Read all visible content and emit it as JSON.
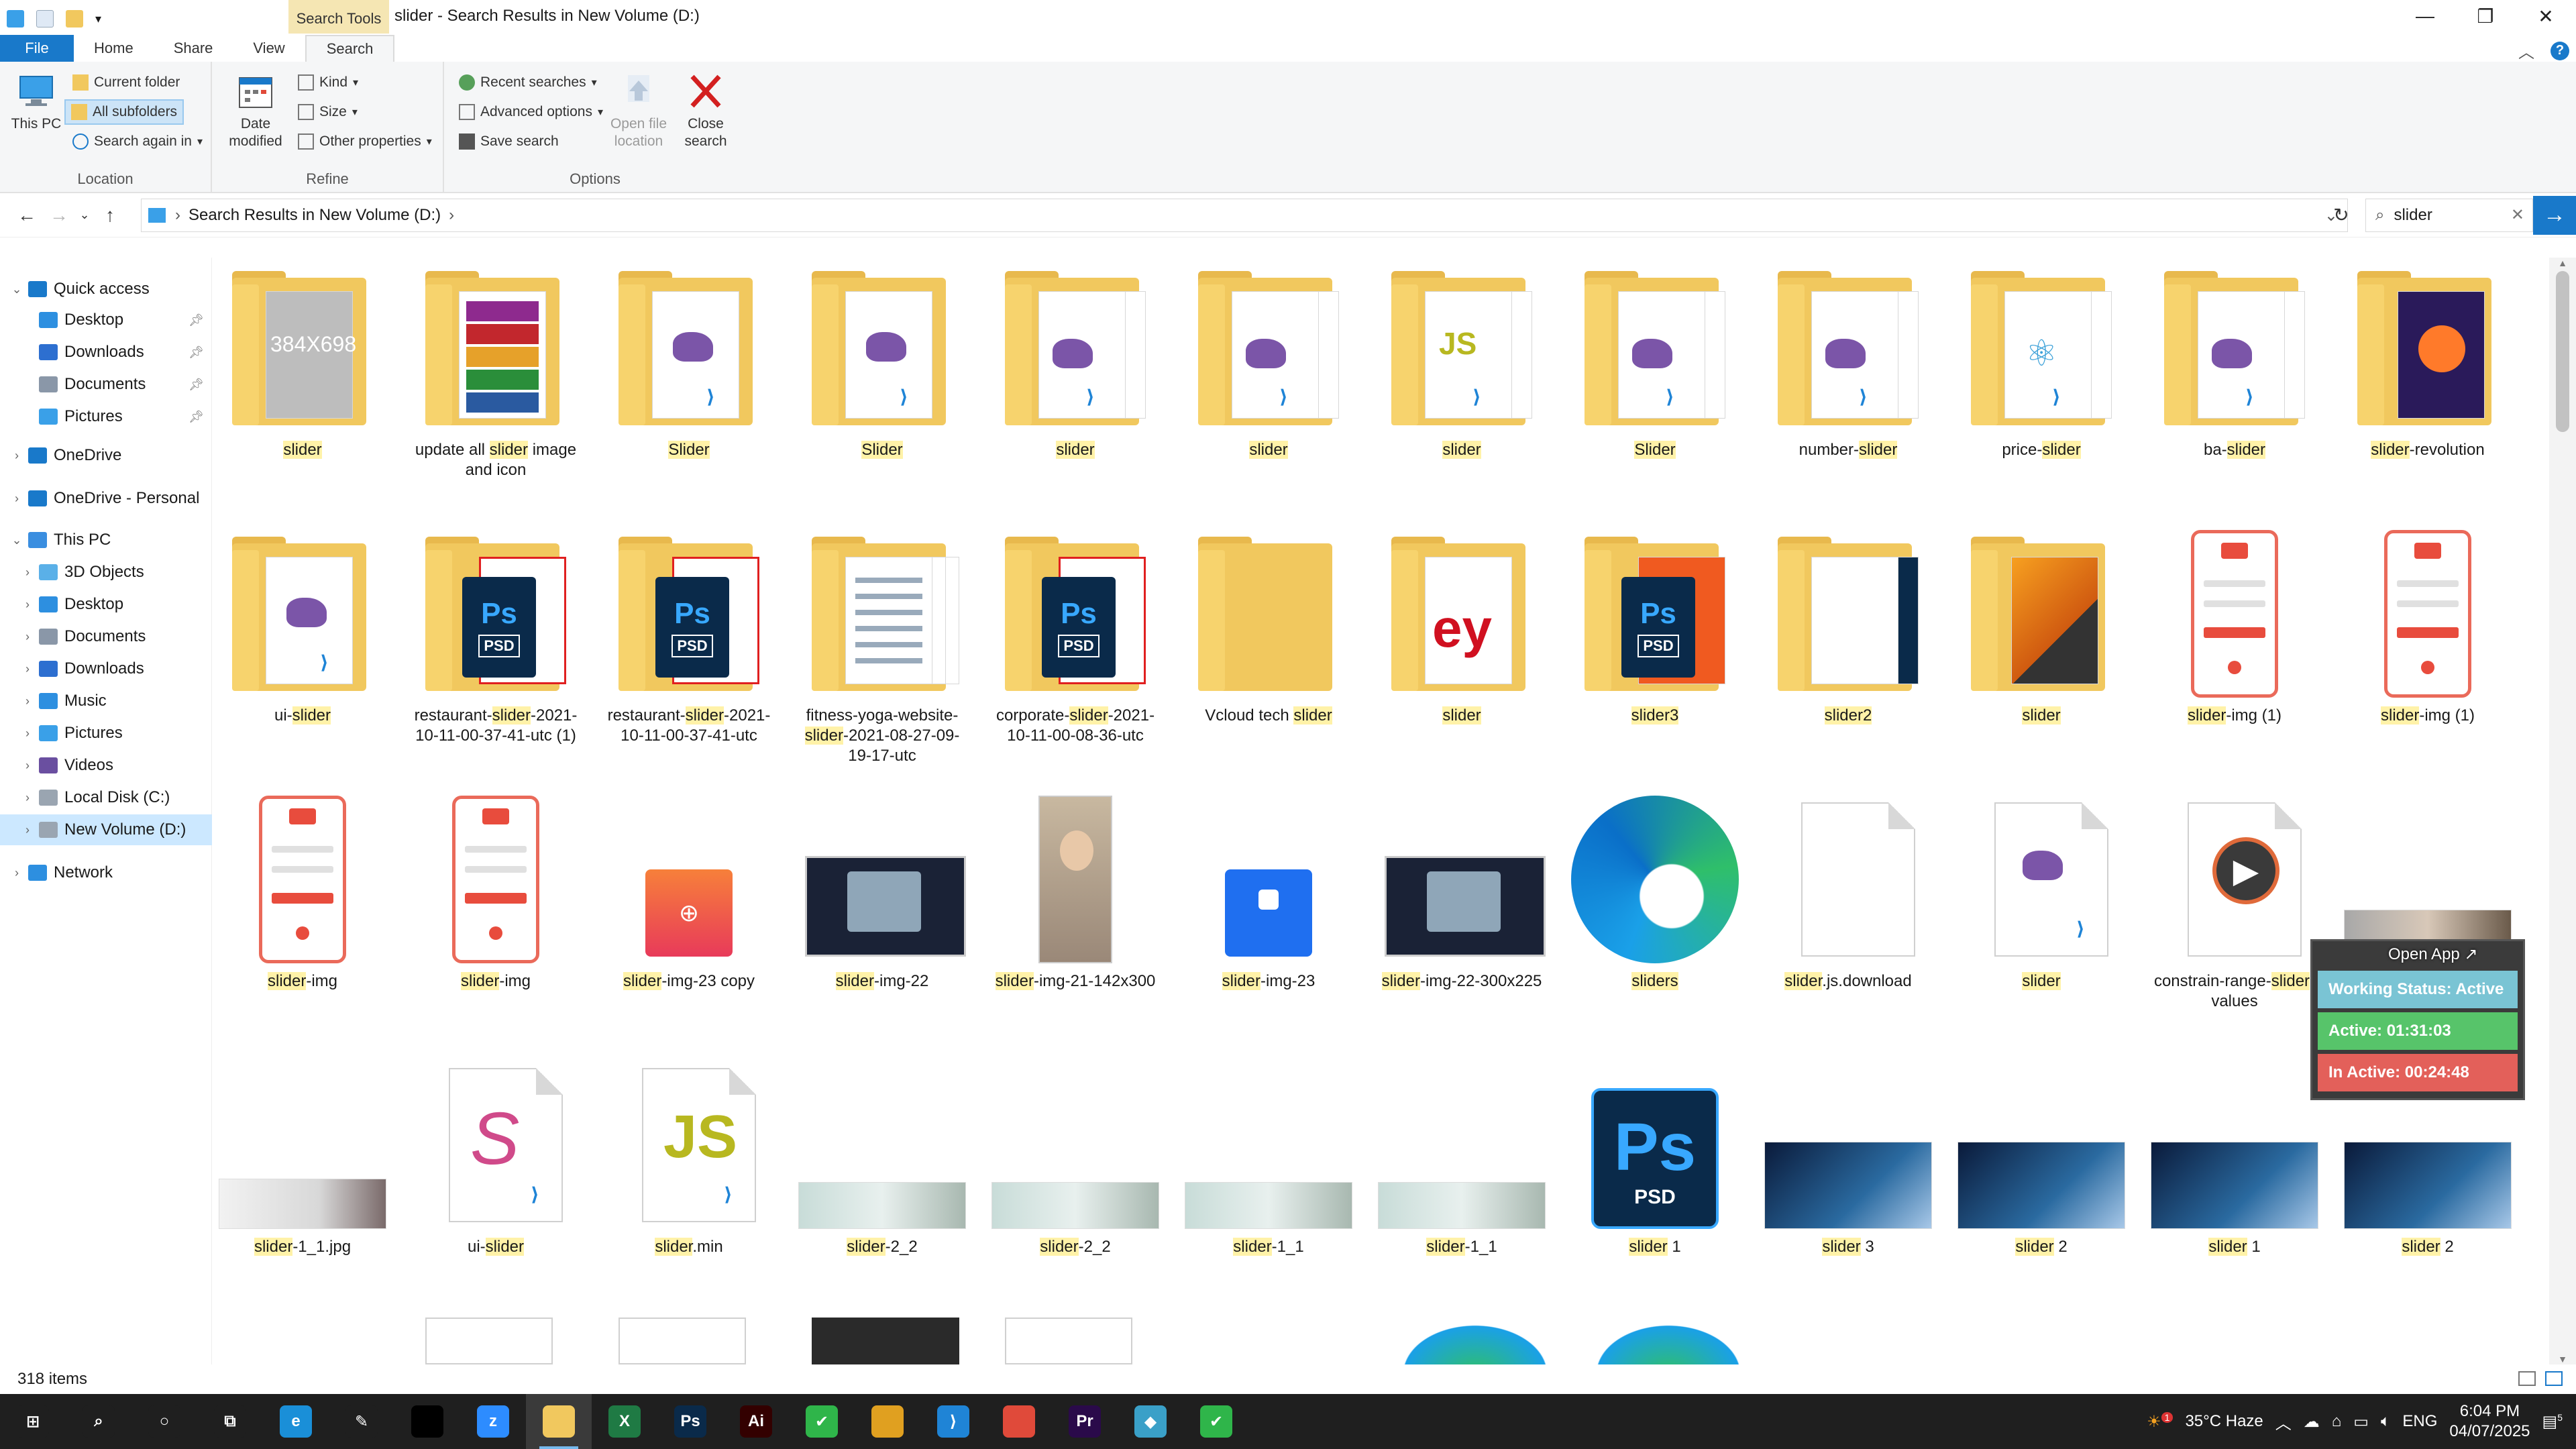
{
  "window": {
    "title": "slider - Search Results in New Volume (D:)",
    "context_tab": "Search Tools",
    "controls": [
      "—",
      "❐",
      "✕"
    ]
  },
  "ribbon_tabs": [
    "File",
    "Home",
    "Share",
    "View",
    "Search"
  ],
  "ribbon": {
    "location": {
      "label": "Location",
      "this_pc": "This PC",
      "current_folder": "Current folder",
      "all_subfolders": "All subfolders",
      "search_again": "Search again in"
    },
    "refine": {
      "label": "Refine",
      "date_modified": "Date modified",
      "kind": "Kind",
      "size": "Size",
      "other_properties": "Other properties"
    },
    "options": {
      "label": "Options",
      "recent_searches": "Recent searches",
      "advanced_options": "Advanced options",
      "save_search": "Save search",
      "open_file_location": "Open file location",
      "close_search": "Close search"
    }
  },
  "address": {
    "path": "Search Results in New Volume (D:)",
    "search_value": "slider"
  },
  "nav": {
    "items": [
      {
        "label": "Quick access",
        "level": 0,
        "color": "#1979ca",
        "pin": false
      },
      {
        "label": "Desktop",
        "level": 1,
        "color": "#2d8fe0",
        "pin": true
      },
      {
        "label": "Downloads",
        "level": 1,
        "color": "#2d6fd0",
        "pin": true
      },
      {
        "label": "Documents",
        "level": 1,
        "color": "#8a97a8",
        "pin": true
      },
      {
        "label": "Pictures",
        "level": 1,
        "color": "#3aa0e8",
        "pin": true
      },
      {
        "label": "OneDrive",
        "level": 0,
        "color": "#1979ca",
        "pin": false
      },
      {
        "label": "OneDrive - Personal",
        "level": 0,
        "color": "#1979ca",
        "pin": false
      },
      {
        "label": "This PC",
        "level": 0,
        "color": "#3a8ee0",
        "pin": false
      },
      {
        "label": "3D Objects",
        "level": 1,
        "color": "#5ab0e8",
        "pin": false
      },
      {
        "label": "Desktop",
        "level": 1,
        "color": "#2d8fe0",
        "pin": false
      },
      {
        "label": "Documents",
        "level": 1,
        "color": "#8a97a8",
        "pin": false
      },
      {
        "label": "Downloads",
        "level": 1,
        "color": "#2d6fd0",
        "pin": false
      },
      {
        "label": "Music",
        "level": 1,
        "color": "#2d8fe0",
        "pin": false
      },
      {
        "label": "Pictures",
        "level": 1,
        "color": "#3aa0e8",
        "pin": false
      },
      {
        "label": "Videos",
        "level": 1,
        "color": "#6a4fa0",
        "pin": false
      },
      {
        "label": "Local Disk (C:)",
        "level": 1,
        "color": "#9aa5b1",
        "pin": false
      },
      {
        "label": "New Volume (D:)",
        "level": 1,
        "color": "#9aa5b1",
        "pin": false,
        "selected": true
      },
      {
        "label": "Network",
        "level": 0,
        "color": "#2d8fe0",
        "pin": false
      }
    ]
  },
  "rows": [
    [
      {
        "kind": "folder-gray",
        "pre": "",
        "hl": "slider",
        "post": ""
      },
      {
        "kind": "folder-rar",
        "pre": "update all ",
        "hl": "slider",
        "post": " image and icon"
      },
      {
        "kind": "folder-vs",
        "pre": "",
        "hl": "Slider",
        "post": ""
      },
      {
        "kind": "folder-vs",
        "pre": "",
        "hl": "Slider",
        "post": ""
      },
      {
        "kind": "folder-vs2",
        "pre": "",
        "hl": "slider",
        "post": ""
      },
      {
        "kind": "folder-vs2",
        "pre": "",
        "hl": "slider",
        "post": ""
      },
      {
        "kind": "folder-js",
        "pre": "",
        "hl": "slider",
        "post": ""
      },
      {
        "kind": "folder-vs2",
        "pre": "",
        "hl": "Slider",
        "post": ""
      },
      {
        "kind": "folder-vs2",
        "pre": "number-",
        "hl": "slider",
        "post": ""
      },
      {
        "kind": "folder-react",
        "pre": "price-",
        "hl": "slider",
        "post": ""
      },
      {
        "kind": "folder-vs2",
        "pre": "ba-",
        "hl": "slider",
        "post": ""
      },
      {
        "kind": "folder-firefox",
        "pre": "",
        "hl": "slider",
        "post": "-revolution"
      }
    ],
    [
      {
        "kind": "folder-vs",
        "pre": "ui-",
        "hl": "slider",
        "post": ""
      },
      {
        "kind": "folder-psd",
        "pre": "restaurant-",
        "hl": "slider",
        "post": "-2021-10-11-00-37-41-utc (1)"
      },
      {
        "kind": "folder-psd",
        "pre": "restaurant-",
        "hl": "slider",
        "post": "-2021-10-11-00-37-41-utc"
      },
      {
        "kind": "folder-docs",
        "pre": "fitness-yoga-website-",
        "hl": "slider",
        "post": "-2021-08-27-09-19-17-utc"
      },
      {
        "kind": "folder-psd",
        "pre": "corporate-",
        "hl": "slider",
        "post": "-2021-10-11-00-08-36-utc"
      },
      {
        "kind": "folder-empty",
        "pre": "Vcloud tech ",
        "hl": "slider",
        "post": ""
      },
      {
        "kind": "folder-red",
        "pre": "",
        "hl": "slider",
        "post": ""
      },
      {
        "kind": "folder-psd-orange",
        "pre": "",
        "hl": "slider3",
        "post": ""
      },
      {
        "kind": "folder-dark",
        "pre": "",
        "hl": "slider2",
        "post": ""
      },
      {
        "kind": "folder-orange",
        "pre": "",
        "hl": "slider",
        "post": ""
      },
      {
        "kind": "phone",
        "pre": "",
        "hl": "slider",
        "post": "-img (1)"
      },
      {
        "kind": "phone",
        "pre": "",
        "hl": "slider",
        "post": "-img (1)"
      }
    ],
    [
      {
        "kind": "phone",
        "pre": "",
        "hl": "slider",
        "post": "-img"
      },
      {
        "kind": "phone",
        "pre": "",
        "hl": "slider",
        "post": "-img"
      },
      {
        "kind": "add-account",
        "pre": "",
        "hl": "slider",
        "post": "-img-23 copy"
      },
      {
        "kind": "meeting",
        "pre": "",
        "hl": "slider",
        "post": "-img-22"
      },
      {
        "kind": "portrait",
        "pre": "",
        "hl": "slider",
        "post": "-img-21-142x300"
      },
      {
        "kind": "join",
        "pre": "",
        "hl": "slider",
        "post": "-img-23"
      },
      {
        "kind": "meeting",
        "pre": "",
        "hl": "slider",
        "post": "-img-22-300x225"
      },
      {
        "kind": "edge",
        "pre": "",
        "hl": "sliders",
        "post": ""
      },
      {
        "kind": "blank",
        "pre": "",
        "hl": "slider",
        "post": ".js.download"
      },
      {
        "kind": "file-vs",
        "pre": "",
        "hl": "slider",
        "post": ""
      },
      {
        "kind": "play",
        "pre": "constrain-range-",
        "hl": "slider",
        "post": "-values"
      },
      {
        "kind": "photo-hidden",
        "pre": "",
        "hl": "",
        "post": ""
      }
    ],
    [
      {
        "kind": "photo-hand",
        "pre": "",
        "hl": "slider",
        "post": "-1_1.jpg"
      },
      {
        "kind": "sass",
        "pre": "ui-",
        "hl": "slider",
        "post": ""
      },
      {
        "kind": "jsfile",
        "pre": "",
        "hl": "slider",
        "post": ".min"
      },
      {
        "kind": "banner",
        "pre": "",
        "hl": "slider",
        "post": "-2_2"
      },
      {
        "kind": "banner",
        "pre": "",
        "hl": "slider",
        "post": "-2_2"
      },
      {
        "kind": "banner",
        "pre": "",
        "hl": "slider",
        "post": "-1_1"
      },
      {
        "kind": "banner",
        "pre": "",
        "hl": "slider",
        "post": "-1_1"
      },
      {
        "kind": "ps-big",
        "pre": "",
        "hl": "slider",
        "post": " 1"
      },
      {
        "kind": "tech",
        "pre": "",
        "hl": "slider",
        "post": " 3"
      },
      {
        "kind": "tech",
        "pre": "",
        "hl": "slider",
        "post": " 2"
      },
      {
        "kind": "tech",
        "pre": "",
        "hl": "slider",
        "post": " 1"
      },
      {
        "kind": "tech",
        "pre": "",
        "hl": "slider",
        "post": " 2"
      }
    ]
  ],
  "widget": {
    "open_app": "Open App ↗",
    "status": "Working Status: Active",
    "active": "Active: 01:31:03",
    "inactive": "In Active: 00:24:48",
    "colors": {
      "status": "#7ac4d4",
      "active": "#57c46a",
      "inactive": "#e3605a"
    }
  },
  "status": {
    "items": "318 items"
  },
  "taskbar": {
    "apps": [
      {
        "name": "start",
        "glyph": "⊞",
        "color": "#1f1f1f"
      },
      {
        "name": "search",
        "glyph": "⌕",
        "color": "#1f1f1f"
      },
      {
        "name": "cortana",
        "glyph": "○",
        "color": "#1f1f1f"
      },
      {
        "name": "task-view",
        "glyph": "⧉",
        "color": "#1f1f1f"
      },
      {
        "name": "edge",
        "glyph": "e",
        "color": "#1a8fd8"
      },
      {
        "name": "pen",
        "glyph": "✎",
        "color": "#1f1f1f"
      },
      {
        "name": "terminal",
        "glyph": "",
        "color": "#000000"
      },
      {
        "name": "zoom",
        "glyph": "z",
        "color": "#2d8cff"
      },
      {
        "name": "file-explorer",
        "glyph": "",
        "color": "#f1c85e",
        "active": true
      },
      {
        "name": "excel",
        "glyph": "X",
        "color": "#1f7a44"
      },
      {
        "name": "photoshop",
        "glyph": "Ps",
        "color": "#0a2a4a"
      },
      {
        "name": "illustrator",
        "glyph": "Ai",
        "color": "#330000"
      },
      {
        "name": "green-app",
        "glyph": "✔",
        "color": "#2fb54a"
      },
      {
        "name": "chrome",
        "glyph": "",
        "color": "#e0a020"
      },
      {
        "name": "vscode",
        "glyph": "⟩",
        "color": "#1f84d6"
      },
      {
        "name": "chrome-2",
        "glyph": "",
        "color": "#e04a3a"
      },
      {
        "name": "premiere",
        "glyph": "Pr",
        "color": "#2a0a4a"
      },
      {
        "name": "app-diamond",
        "glyph": "◆",
        "color": "#3aa0c8"
      },
      {
        "name": "green-app-2",
        "glyph": "✔",
        "color": "#2fb54a"
      }
    ],
    "weather": "35°C Haze",
    "weather_badge": "1",
    "lang": "ENG",
    "time": "6:04 PM",
    "date": "04/07/2025",
    "notif": "5"
  }
}
